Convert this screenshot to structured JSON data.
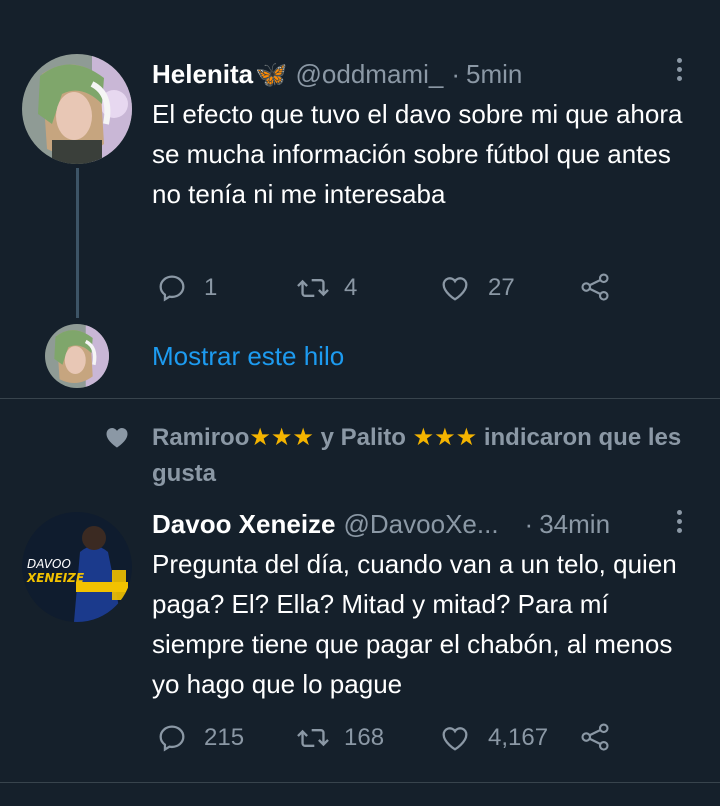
{
  "tweet1": {
    "name": "Helenita",
    "name_emoji": "🦋",
    "handle": "@oddmami_",
    "separator": "·",
    "time": "5min",
    "text": "El efecto que tuvo el davo sobre mi que ahora se mucha información sobre fútbol que antes no tenía ni me interesaba",
    "replies": "1",
    "retweets": "4",
    "likes": "27"
  },
  "thread": {
    "show_label": "Mostrar este hilo"
  },
  "social_context": {
    "user1": "Ramiroo",
    "user1_stars": "★★★",
    "connector": " y Palito ",
    "user2_stars": "★★★",
    "suffix": " indicaron que les gusta"
  },
  "tweet2": {
    "name": "Davoo Xeneize",
    "handle": "@DavooXe...",
    "separator": "·",
    "time": "34min",
    "text": "Pregunta del día, cuando van a un telo, quien paga? El? Ella? Mitad y mitad? Para mí siempre tiene que pagar el chabón, al menos yo hago que lo pague",
    "replies": "215",
    "retweets": "168",
    "likes": "4,167",
    "avatar_text_line1": "DAVOO",
    "avatar_text_line2": "XENEIZE"
  },
  "colors": {
    "background": "#15202b",
    "secondary_text": "#8b98a5",
    "link": "#1d9bf0",
    "divider": "#38444d",
    "star": "#f4b400"
  }
}
